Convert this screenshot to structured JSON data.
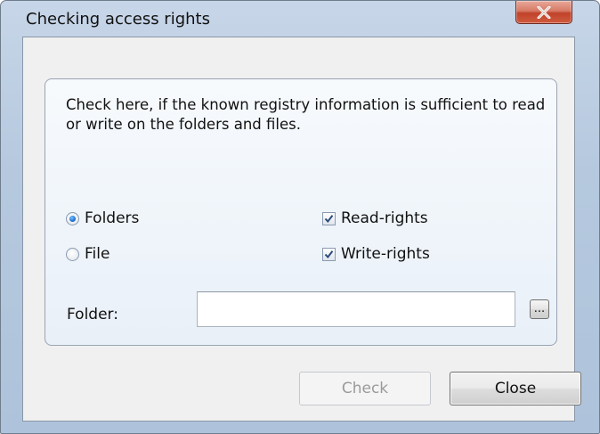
{
  "window": {
    "title": "Checking access rights",
    "close_icon": "close-x-icon"
  },
  "group": {
    "description": "Check here, if the known registry information is sufficient to read or write on the folders and files."
  },
  "target_type": {
    "options": [
      {
        "label": "Folders",
        "selected": true
      },
      {
        "label": "File",
        "selected": false
      }
    ]
  },
  "rights": {
    "read": {
      "label": "Read-rights",
      "checked": true
    },
    "write": {
      "label": "Write-rights",
      "checked": true
    }
  },
  "folder": {
    "label": "Folder:",
    "value": "",
    "browse_label": "..."
  },
  "buttons": {
    "check": {
      "label": "Check",
      "enabled": false
    },
    "close": {
      "label": "Close",
      "enabled": true
    }
  },
  "colors": {
    "accent": "#1c6fd1",
    "close_button": "#c0432a",
    "frame": "#b5c8de"
  }
}
